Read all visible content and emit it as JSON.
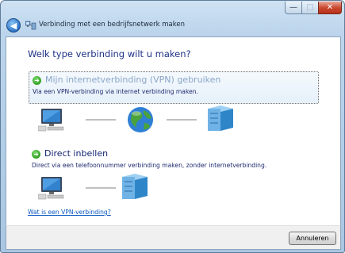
{
  "window": {
    "title": "Verbinding met een bedrijfsnetwerk maken",
    "controls": {
      "minimize": "—",
      "maximize": "□",
      "close": "✕"
    }
  },
  "nav": {
    "back_icon": "back-arrow-icon",
    "back_glyph": "◀"
  },
  "main": {
    "question": "Welk type verbinding wilt u maken?",
    "options": [
      {
        "title": "Mijn internetverbinding (VPN) gebruiken",
        "description": "Via een VPN-verbinding via internet verbinding maken.",
        "diagram_icons": [
          "computer-icon",
          "globe-icon",
          "server-icon"
        ],
        "state": "hover-selected"
      },
      {
        "title": "Direct inbellen",
        "description": "Direct via een telefoonnummer verbinding maken, zonder internetverbinding.",
        "diagram_icons": [
          "computer-icon",
          "server-icon"
        ],
        "state": "normal"
      }
    ],
    "help_link": "Wat is een VPN-verbinding?"
  },
  "footer": {
    "cancel_label": "Annuleren"
  },
  "colors": {
    "heading": "#1e3287",
    "link": "#0a58c2",
    "option_disabled_text": "#8aa6c8",
    "option_title": "#0f1f6e",
    "arrow_green": "#2a9b1c",
    "chrome": "#bcd5ec"
  }
}
